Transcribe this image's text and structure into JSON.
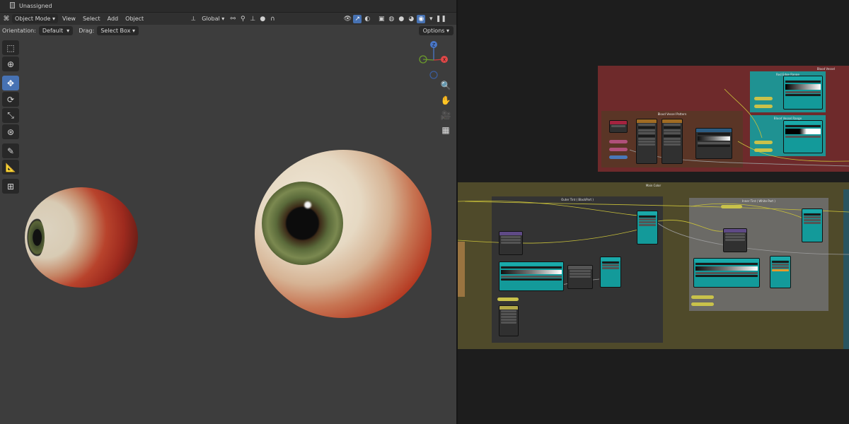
{
  "viewport": {
    "material_slot": "Unassigned",
    "header": {
      "mode": "Object Mode",
      "menus": [
        "View",
        "Select",
        "Add",
        "Object"
      ],
      "transform": "Global"
    },
    "header2": {
      "orientation_label": "Orientation:",
      "orientation_value": "Default",
      "drag_label": "Drag:",
      "drag_value": "Select Box",
      "options_label": "Options"
    },
    "toolbar": [
      {
        "icon": "select-box-icon",
        "active": false
      },
      {
        "icon": "cursor-icon",
        "active": false
      },
      {
        "icon": "move-icon",
        "active": true
      },
      {
        "icon": "rotate-icon",
        "active": false
      },
      {
        "icon": "scale-icon",
        "active": false
      },
      {
        "icon": "transform-icon",
        "active": false
      },
      {
        "icon": "annotate-icon",
        "active": false
      },
      {
        "icon": "measure-icon",
        "active": false
      },
      {
        "icon": "add-cube-icon",
        "active": false
      }
    ],
    "gizmo": {
      "z": "Z",
      "x": "X"
    },
    "colors": {
      "active": "#4772b3",
      "bg": "#3d3d3d"
    }
  },
  "node_editor": {
    "frames": {
      "blood_vessel": "Blood Vessel",
      "red_edge_range": "Red Edge Range",
      "blood_vessel_range": "Blood Vessel Range",
      "blood_vessel_pattern": "Blood Vessel Pattern",
      "main_color": "Main Color",
      "outer_tint": "Outer Tint ( BlackPart )",
      "inner_tint": "Inner Tint ( White Part )"
    }
  }
}
